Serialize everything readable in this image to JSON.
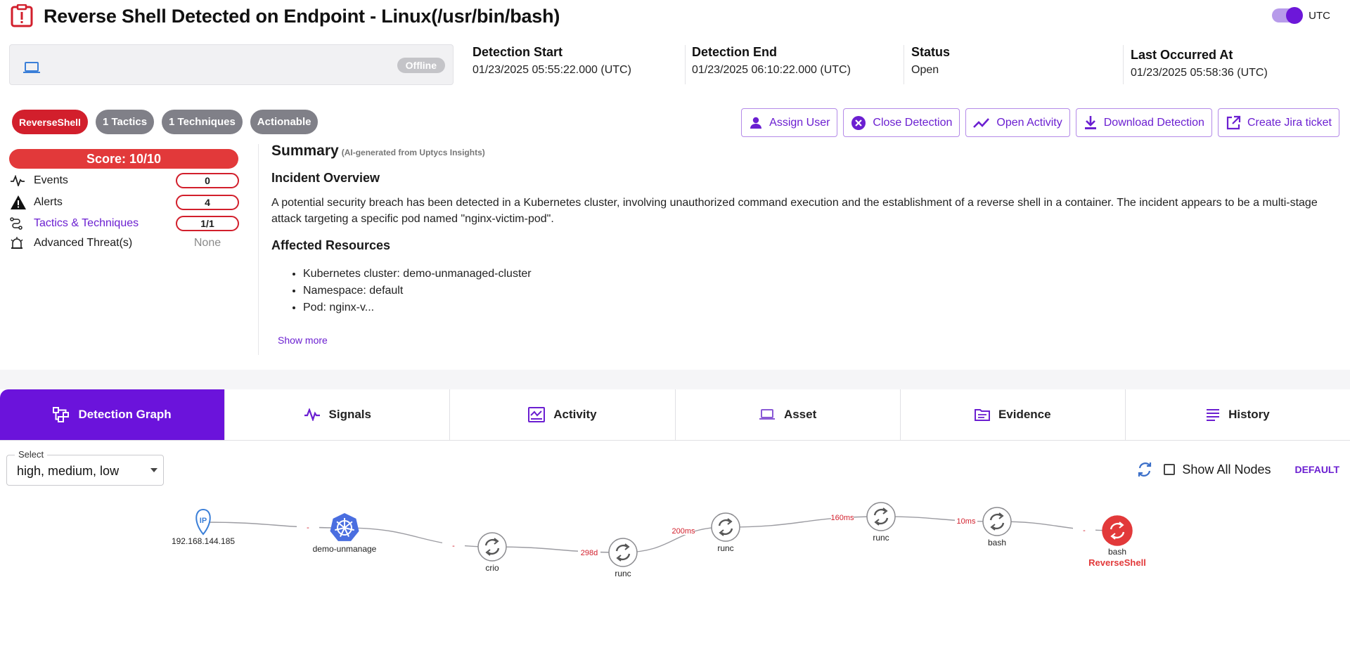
{
  "header": {
    "title": "Reverse Shell Detected on Endpoint - Linux(/usr/bin/bash)",
    "utc_label": "UTC"
  },
  "asset": {
    "status": "Offline"
  },
  "meta": [
    {
      "label": "Detection Start",
      "value": "01/23/2025 05:55:22.000 (UTC)"
    },
    {
      "label": "Detection End",
      "value": "01/23/2025 06:10:22.000 (UTC)"
    },
    {
      "label": "Status",
      "value": "Open"
    },
    {
      "label": "Last Occurred At",
      "value": "01/23/2025 05:58:36 (UTC)"
    }
  ],
  "tags": [
    "ReverseShell",
    "1 Tactics",
    "1 Techniques",
    "Actionable"
  ],
  "actions": [
    "Assign User",
    "Close Detection",
    "Open Activity",
    "Download Detection",
    "Create Jira ticket"
  ],
  "score": {
    "label": "Score: 10/10",
    "events": {
      "name": "Events",
      "value": "0"
    },
    "alerts": {
      "name": "Alerts",
      "value": "4"
    },
    "tactics": {
      "name": "Tactics & Techniques",
      "value": "1/1"
    },
    "threats": {
      "name": "Advanced Threat(s)",
      "value": "None"
    }
  },
  "summary": {
    "title": "Summary",
    "subtitle": "(AI-generated from Uptycs Insights)",
    "overview_heading": "Incident Overview",
    "overview_text": "A potential security breach has been detected in a Kubernetes cluster, involving unauthorized command execution and the establishment of a reverse shell in a container. The incident appears to be a multi-stage attack targeting a specific pod named \"nginx-victim-pod\".",
    "resources_heading": "Affected Resources",
    "resources": [
      "Kubernetes cluster: demo-unmanaged-cluster",
      "Namespace: default",
      "Pod: nginx-v..."
    ],
    "show_more": "Show more"
  },
  "tabs": [
    "Detection Graph",
    "Signals",
    "Activity",
    "Asset",
    "Evidence",
    "History"
  ],
  "graph_toolbar": {
    "select_legend": "Select",
    "select_value": "high, medium, low",
    "show_all_nodes": "Show All Nodes",
    "default_label": "DEFAULT"
  },
  "graph": {
    "nodes": [
      {
        "id": "ip",
        "label": "192.168.144.185",
        "kind": "ip"
      },
      {
        "id": "k8s",
        "label": "demo-unmanage",
        "kind": "k8s"
      },
      {
        "id": "crio",
        "label": "crio",
        "kind": "proc"
      },
      {
        "id": "runc1",
        "label": "runc",
        "kind": "proc"
      },
      {
        "id": "runc2",
        "label": "runc",
        "kind": "proc"
      },
      {
        "id": "runc3",
        "label": "runc",
        "kind": "proc"
      },
      {
        "id": "bash1",
        "label": "bash",
        "kind": "proc"
      },
      {
        "id": "bash2",
        "label": "bash",
        "kind": "alert",
        "sublabel": "ReverseShell"
      }
    ],
    "edges": [
      {
        "label": "-"
      },
      {
        "label": "-"
      },
      {
        "label": "298d"
      },
      {
        "label": "200ms"
      },
      {
        "label": "160ms"
      },
      {
        "label": "10ms"
      },
      {
        "label": "-"
      }
    ],
    "colors": {
      "accent": "#6b13db",
      "alert": "#e2393a",
      "k8s": "#4a6ee0"
    }
  }
}
